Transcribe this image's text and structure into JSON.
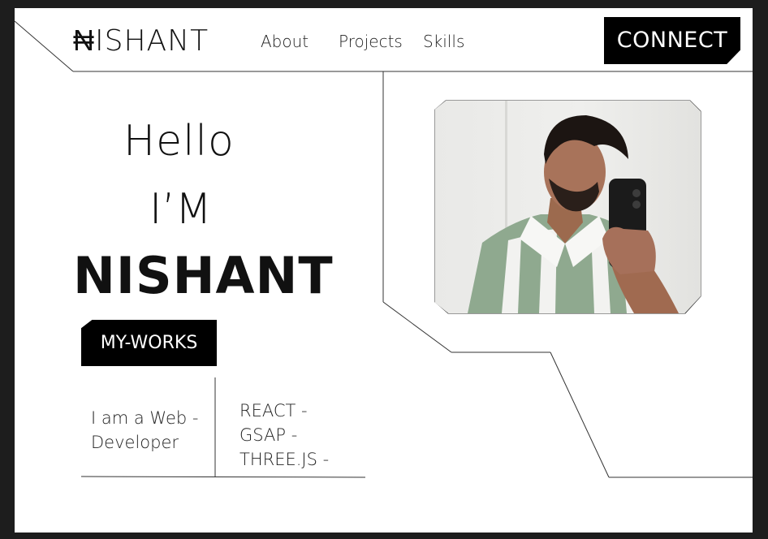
{
  "header": {
    "logo": "₦ISHANT",
    "nav": {
      "about": "About",
      "projects": "Projects",
      "skills": "Skills"
    },
    "connect_label": "CONNECT"
  },
  "hero": {
    "greeting": "Hello",
    "im": "I’M",
    "name": "NISHANT",
    "works_label": "MY-WORKS"
  },
  "info": {
    "role_line1": "I am a Web -",
    "role_line2": "Developer",
    "skills": [
      "REACT -",
      "GSAP -",
      "THREE.JS -"
    ]
  },
  "colors": {
    "background": "#ffffff",
    "frame": "#1d1d1d",
    "accent": "#000000",
    "text": "#111111"
  }
}
